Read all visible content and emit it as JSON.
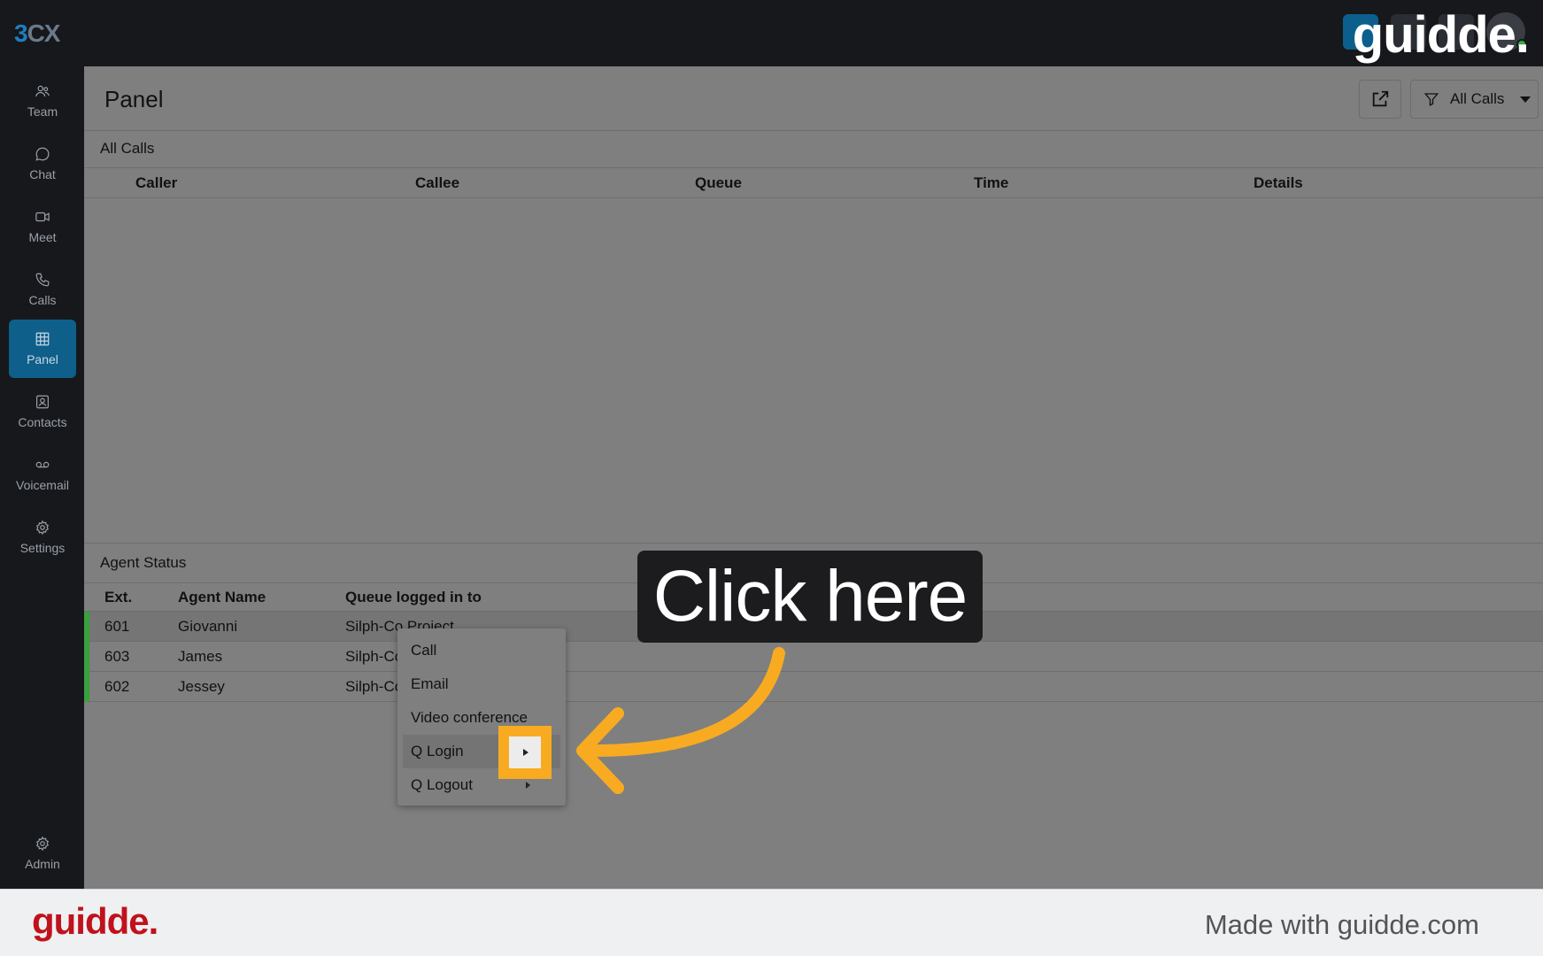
{
  "app": {
    "logo_three": "3",
    "logo_cx": "CX"
  },
  "watermark": {
    "top": "guidde.",
    "footer_logo": "guidde.",
    "footer_text": "Made with guidde.com"
  },
  "sidebar": {
    "items": [
      {
        "label": "Team",
        "icon": "team-icon"
      },
      {
        "label": "Chat",
        "icon": "chat-icon"
      },
      {
        "label": "Meet",
        "icon": "video-icon"
      },
      {
        "label": "Calls",
        "icon": "phone-icon"
      },
      {
        "label": "Panel",
        "icon": "grid-icon",
        "active": true
      },
      {
        "label": "Contacts",
        "icon": "contact-icon"
      },
      {
        "label": "Voicemail",
        "icon": "voicemail-icon"
      },
      {
        "label": "Settings",
        "icon": "gear-icon"
      }
    ],
    "admin": {
      "label": "Admin",
      "icon": "admin-gear-icon"
    }
  },
  "header": {
    "title": "Panel",
    "filter_label": "All Calls"
  },
  "calls": {
    "section_label": "All Calls",
    "columns": [
      "Caller",
      "Callee",
      "Queue",
      "Time",
      "Details"
    ]
  },
  "agents": {
    "section_label": "Agent Status",
    "columns": [
      "Ext.",
      "Agent Name",
      "Queue logged in to"
    ],
    "rows": [
      {
        "ext": "601",
        "name": "Giovanni",
        "queue": "Silph-Co Project"
      },
      {
        "ext": "603",
        "name": "James",
        "queue": "Silph-Co"
      },
      {
        "ext": "602",
        "name": "Jessey",
        "queue": "Silph-Co"
      }
    ]
  },
  "context_menu": {
    "items": [
      "Call",
      "Email",
      "Video conference",
      "Q Login",
      "Q Logout"
    ]
  },
  "callout": {
    "text": "Click here"
  },
  "colors": {
    "accent": "#0e5f8a",
    "status_green": "#37a23b",
    "highlight": "#f8ab21",
    "brand_red": "#c0121c"
  }
}
